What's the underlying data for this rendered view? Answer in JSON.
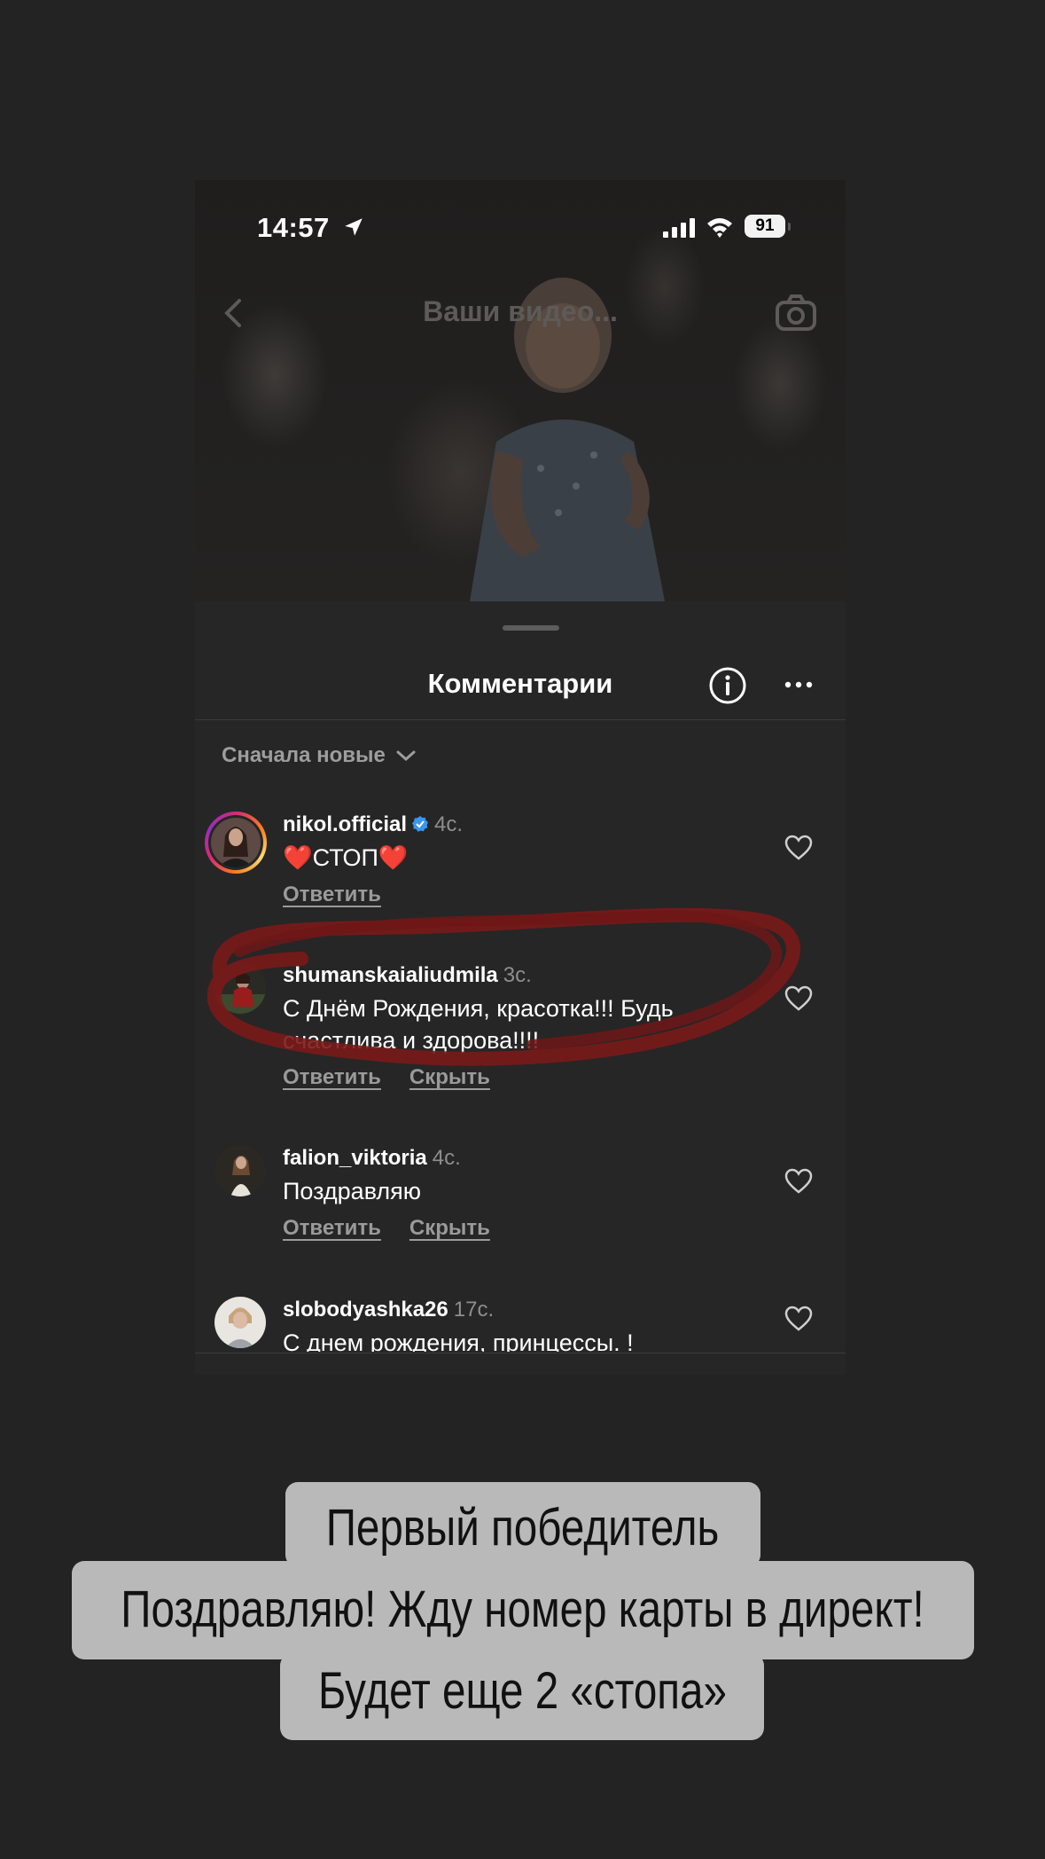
{
  "status_bar": {
    "time": "14:57",
    "battery": "91"
  },
  "video_header": {
    "title": "Ваши видео..."
  },
  "comments_sheet": {
    "title": "Комментарии",
    "sort_label": "Сначала новые",
    "comments": [
      {
        "username": "nikol.official",
        "verified": true,
        "time": "4с.",
        "text": "❤️СТОП❤️",
        "actions": [
          "Ответить"
        ]
      },
      {
        "username": "shumanskaialiudmila",
        "verified": false,
        "time": "3с.",
        "text": "С Днём Рождения, красотка!!! Будь счастлива и здорова!!!!",
        "actions": [
          "Ответить",
          "Скрыть"
        ],
        "highlighted": true
      },
      {
        "username": "falion_viktoria",
        "verified": false,
        "time": "4с.",
        "text": "Поздравляю",
        "actions": [
          "Ответить",
          "Скрыть"
        ]
      },
      {
        "username": "slobodyashka26",
        "verified": false,
        "time": "17с.",
        "text": "С днем рождения,  принцессы. !",
        "actions": []
      }
    ]
  },
  "caption": {
    "line1": "Первый победитель",
    "line2": "Поздравляю! Жду номер карты в директ!",
    "line3": "Будет еще 2 «стопа»"
  },
  "colors": {
    "background": "#232323",
    "sheet": "#262626",
    "caption_box": "#b9b9b9",
    "highlight_scribble": "#7a1a1a",
    "verified_badge": "#3897f0"
  }
}
